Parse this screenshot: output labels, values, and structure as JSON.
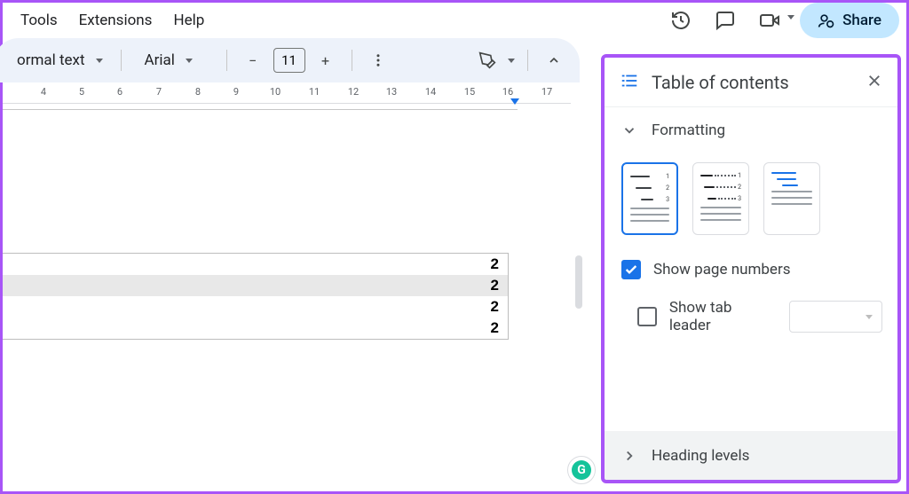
{
  "menu": {
    "tools": "Tools",
    "extensions": "Extensions",
    "help": "Help"
  },
  "topright": {
    "share": "Share"
  },
  "toolbar": {
    "style": "ormal text",
    "font": "Arial",
    "fontsize": "11",
    "minus": "−",
    "plus": "+"
  },
  "ruler": {
    "marks": [
      {
        "pos": 46,
        "label": "4"
      },
      {
        "pos": 89,
        "label": "5"
      },
      {
        "pos": 132,
        "label": "6"
      },
      {
        "pos": 176,
        "label": "7"
      },
      {
        "pos": 220,
        "label": "8"
      },
      {
        "pos": 263,
        "label": "9"
      },
      {
        "pos": 307,
        "label": "10"
      },
      {
        "pos": 351,
        "label": "11"
      },
      {
        "pos": 395,
        "label": "12"
      },
      {
        "pos": 438,
        "label": "13"
      },
      {
        "pos": 482,
        "label": "14"
      },
      {
        "pos": 526,
        "label": "15"
      },
      {
        "pos": 569,
        "label": "16"
      },
      {
        "pos": 613,
        "label": "17"
      }
    ]
  },
  "doc": {
    "toc_rows": [
      {
        "num": "2",
        "highlight": false
      },
      {
        "num": "2",
        "highlight": true
      },
      {
        "num": "2",
        "highlight": false
      },
      {
        "num": "2",
        "highlight": false
      }
    ]
  },
  "panel": {
    "title": "Table of contents",
    "formatting": "Formatting",
    "show_page_numbers": "Show page numbers",
    "show_tab_leader": "Show tab leader",
    "heading_levels": "Heading levels"
  },
  "grammarly": "G"
}
